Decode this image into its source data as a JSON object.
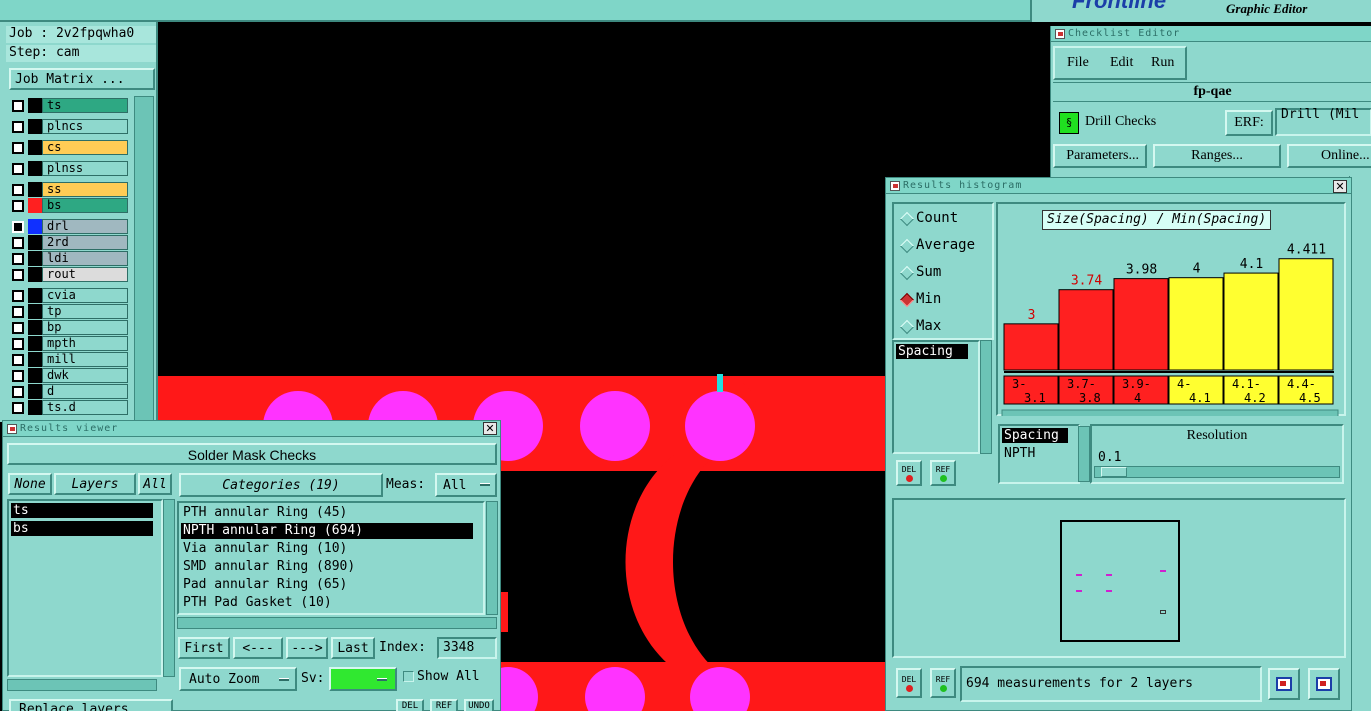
{
  "header": {
    "brand": "Frontline",
    "subtitle": "Graphic Editor"
  },
  "left_panel": {
    "job_line": "Job : 2v2fpqwha0",
    "step_line": "Step: cam",
    "job_matrix_label": "Job Matrix ...",
    "layers": [
      {
        "name": "ts",
        "bg": "#2ea883",
        "swatch": "#000"
      },
      {
        "name": "plncs",
        "bg": "#8ed8cd",
        "swatch": "#000"
      },
      {
        "name": "cs",
        "bg": "#ffcc55",
        "swatch": "#000"
      },
      {
        "name": "plnss",
        "bg": "#8ed8cd",
        "swatch": "#000"
      },
      {
        "name": "ss",
        "bg": "#ffcc55",
        "swatch": "#000"
      },
      {
        "name": "bs",
        "bg": "#2ea883",
        "swatch": "#ff2020"
      },
      {
        "name": "drl",
        "bg": "#a0b8c0",
        "swatch": "#1030ff"
      },
      {
        "name": "2rd",
        "bg": "#a0b8c0",
        "swatch": "#000"
      },
      {
        "name": "ldi",
        "bg": "#a0b8c0",
        "swatch": "#000"
      },
      {
        "name": "rout",
        "bg": "#dcdcdc",
        "swatch": "#000"
      },
      {
        "name": "cvia",
        "bg": "#8ed8cd",
        "swatch": "#000"
      },
      {
        "name": "tp",
        "bg": "#8ed8cd",
        "swatch": "#000"
      },
      {
        "name": "bp",
        "bg": "#8ed8cd",
        "swatch": "#000"
      },
      {
        "name": "mpth",
        "bg": "#8ed8cd",
        "swatch": "#000"
      },
      {
        "name": "mill",
        "bg": "#8ed8cd",
        "swatch": "#000"
      },
      {
        "name": "dwk",
        "bg": "#8ed8cd",
        "swatch": "#000"
      },
      {
        "name": "d",
        "bg": "#8ed8cd",
        "swatch": "#000"
      },
      {
        "name": "ts.d",
        "bg": "#8ed8cd",
        "swatch": "#000"
      }
    ]
  },
  "results_viewer": {
    "title": "Results viewer",
    "heading": "Solder Mask Checks",
    "none_label": "None",
    "layers_label": "Layers",
    "all_label": "All",
    "layer_list": [
      "ts",
      "bs"
    ],
    "categories_label": "Categories (19)",
    "meas_label": "Meas:",
    "meas_value": "All",
    "categories": [
      "PTH annular Ring (45)",
      "NPTH annular Ring (694)",
      "Via annular Ring (10)",
      "SMD annular Ring (890)",
      "Pad annular Ring (65)",
      "PTH Pad Gasket (10)"
    ],
    "selected_category": 1,
    "first_label": "First",
    "prev_label": "<---",
    "next_label": "--->",
    "last_label": "Last",
    "index_label": "Index:",
    "index_value": "3348",
    "auto_zoom_label": "Auto Zoom",
    "sv_label": "Sv:",
    "show_all_label": "Show All",
    "replace_layers_label": "Replace layers",
    "del_label": "DEL",
    "ref_label": "REF",
    "undo_label": "UNDO"
  },
  "checklist_editor": {
    "title": "Checklist Editor",
    "menu": [
      "File",
      "Edit",
      "Run"
    ],
    "name": "fp-qae",
    "check_name": "Drill Checks",
    "erf_label": "ERF:",
    "erf_value": "Drill (Mil",
    "parameters_label": "Parameters...",
    "ranges_label": "Ranges...",
    "online_label": "Online..."
  },
  "histogram": {
    "title": "Results histogram",
    "modes": [
      "Count",
      "Average",
      "Sum",
      "Min",
      "Max"
    ],
    "selected_mode": 3,
    "chart_title": "Size(Spacing) / Min(Spacing)",
    "list_item": "Spacing",
    "attr_items": [
      "Spacing",
      "NPTH"
    ],
    "resolution_label": "Resolution",
    "resolution_value": "0.1",
    "del_label": "DEL",
    "ref_label": "REF",
    "status": "694 measurements for 2 layers"
  },
  "chart_data": {
    "type": "bar",
    "title": "Size(Spacing) / Min(Spacing)",
    "categories": [
      "3-3.1",
      "3.7-3.8",
      "3.9-4",
      "4-4.1",
      "4.1-4.2",
      "4.4-4.5"
    ],
    "category_top": [
      "3-",
      "3.7-",
      "3.9-",
      "4-",
      "4.1-",
      "4.4-"
    ],
    "category_bottom": [
      "3.1",
      "3.8",
      "4",
      "4.1",
      "4.2",
      "4.5"
    ],
    "values": [
      3,
      3.74,
      3.98,
      4,
      4.1,
      4.411
    ],
    "value_labels": [
      "3",
      "3.74",
      "3.98",
      "4",
      "4.1",
      "4.411"
    ],
    "colors": [
      "#ff2020",
      "#ff2020",
      "#ff2020",
      "#ffff30",
      "#ffff30",
      "#ffff30"
    ],
    "label_colors": [
      "#d00000",
      "#d00000",
      "#000000",
      "#000000",
      "#000000",
      "#000000"
    ],
    "ylim": [
      0,
      4.6
    ]
  }
}
